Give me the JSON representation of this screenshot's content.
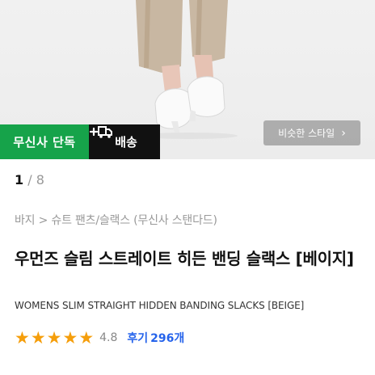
{
  "hero": {
    "badge_exclusive": "무신사 단독",
    "badge_delivery": "배송",
    "similar_style_label": "비슷한 스타일",
    "similar_style_chevron": "›"
  },
  "pager": {
    "current": "1",
    "separator": "/",
    "total": "8"
  },
  "breadcrumb": "바지 > 슈트 팬츠/슬랙스 (무신사 스탠다드)",
  "product": {
    "title_ko": "우먼즈 슬림 스트레이트 히든 밴딩 슬랙스 [베이지]",
    "title_en": "WOMENS SLIM STRAIGHT HIDDEN BANDING SLACKS [BEIGE]",
    "rating": "4.8",
    "rating_value": 4.8,
    "rating_max": 5,
    "reviews_label": "후기",
    "reviews_count": "296개"
  },
  "colors": {
    "exclusive_badge": "#16a34a",
    "delivery_badge": "#111111",
    "star": "#f59e0b",
    "review_link": "#2563eb"
  }
}
